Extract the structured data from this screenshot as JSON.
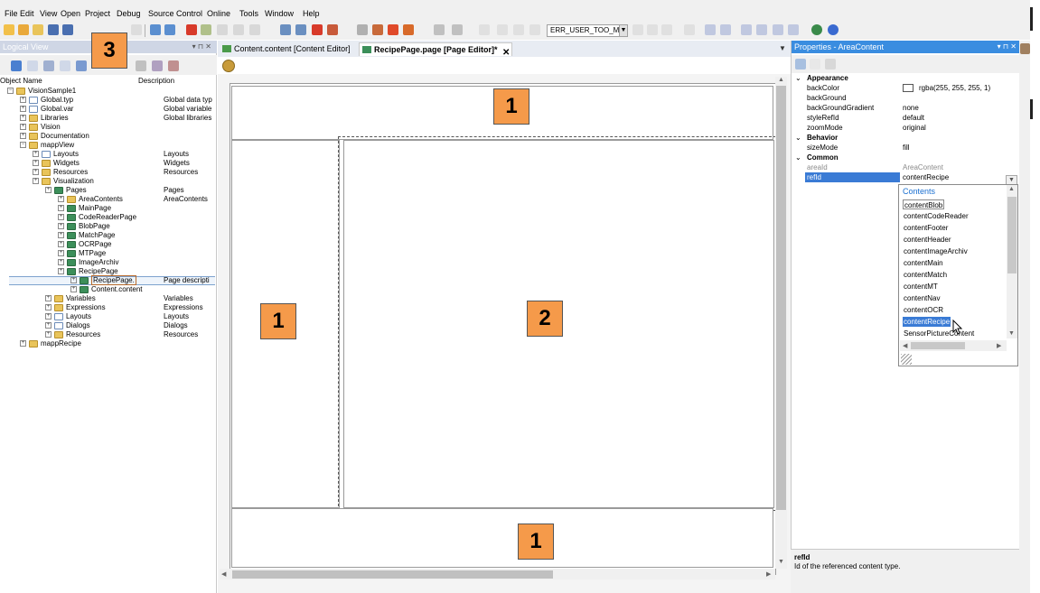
{
  "menu": [
    "File",
    "Edit",
    "View",
    "Open",
    "Project",
    "Debug",
    "Source Control",
    "Online",
    "Tools",
    "Window",
    "Help"
  ],
  "toolbar": {
    "error_combo_value": "ERR_USER_TOO_MA"
  },
  "logical_view": {
    "title": "Logical View",
    "col_object_name": "Object Name",
    "col_description": "Description",
    "tree": [
      {
        "label": "VisionSample1",
        "desc": "",
        "level": 0,
        "icon": "folder-icon"
      },
      {
        "label": "Global.typ",
        "desc": "Global data typ",
        "level": 1,
        "icon": "file-icon"
      },
      {
        "label": "Global.var",
        "desc": "Global variable",
        "level": 1,
        "icon": "file-icon"
      },
      {
        "label": "Libraries",
        "desc": "Global libraries",
        "level": 1,
        "icon": "folder-icon"
      },
      {
        "label": "Vision",
        "desc": "",
        "level": 1,
        "icon": "folder-icon"
      },
      {
        "label": "Documentation",
        "desc": "",
        "level": 1,
        "icon": "folder-icon"
      },
      {
        "label": "mappView",
        "desc": "",
        "level": 1,
        "icon": "folder-icon"
      },
      {
        "label": "Layouts",
        "desc": "Layouts",
        "level": 2,
        "icon": "file-icon"
      },
      {
        "label": "Widgets",
        "desc": "Widgets",
        "level": 2,
        "icon": "folder-icon"
      },
      {
        "label": "Resources",
        "desc": "Resources",
        "level": 2,
        "icon": "folder-icon"
      },
      {
        "label": "Visualization",
        "desc": "",
        "level": 2,
        "icon": "folder-icon"
      },
      {
        "label": "Pages",
        "desc": "Pages",
        "level": 3,
        "icon": "page-icon"
      },
      {
        "label": "AreaContents",
        "desc": "AreaContents",
        "level": 4,
        "icon": "folder-icon"
      },
      {
        "label": "MainPage",
        "desc": "",
        "level": 4,
        "icon": "page-icon"
      },
      {
        "label": "CodeReaderPage",
        "desc": "",
        "level": 4,
        "icon": "page-icon"
      },
      {
        "label": "BlobPage",
        "desc": "",
        "level": 4,
        "icon": "page-icon"
      },
      {
        "label": "MatchPage",
        "desc": "",
        "level": 4,
        "icon": "page-icon"
      },
      {
        "label": "OCRPage",
        "desc": "",
        "level": 4,
        "icon": "page-icon"
      },
      {
        "label": "MTPage",
        "desc": "",
        "level": 4,
        "icon": "page-icon"
      },
      {
        "label": "ImageArchiv",
        "desc": "",
        "level": 4,
        "icon": "page-icon"
      },
      {
        "label": "RecipePage",
        "desc": "",
        "level": 4,
        "icon": "page-icon"
      },
      {
        "label": "RecipePage.",
        "desc": "Page descripti",
        "level": 5,
        "icon": "page-icon",
        "selected": true
      },
      {
        "label": "Content.content",
        "desc": "",
        "level": 5,
        "icon": "page-icon"
      },
      {
        "label": "Variables",
        "desc": "Variables",
        "level": 3,
        "icon": "folder-icon"
      },
      {
        "label": "Expressions",
        "desc": "Expressions",
        "level": 3,
        "icon": "folder-icon"
      },
      {
        "label": "Layouts",
        "desc": "Layouts",
        "level": 3,
        "icon": "file-icon"
      },
      {
        "label": "Dialogs",
        "desc": "Dialogs",
        "level": 3,
        "icon": "file-icon"
      },
      {
        "label": "Resources",
        "desc": "Resources",
        "level": 3,
        "icon": "folder-icon"
      },
      {
        "label": "mappRecipe",
        "desc": "",
        "level": 1,
        "icon": "folder-icon"
      }
    ]
  },
  "editor": {
    "tabs": [
      {
        "label": "Content.content [Content Editor]",
        "active": false
      },
      {
        "label": "RecipePage.page [Page Editor]*",
        "active": true
      }
    ]
  },
  "badges": {
    "top": "1",
    "left": "1",
    "center": "2",
    "bottom": "1",
    "panel": "3"
  },
  "properties": {
    "title": "Properties - AreaContent",
    "rows": [
      {
        "name": "Appearance",
        "value": "",
        "category": true
      },
      {
        "name": "backColor",
        "value": "rgba(255, 255, 255, 1)",
        "swatch": true
      },
      {
        "name": "backGround",
        "value": ""
      },
      {
        "name": "backGroundGradient",
        "value": "none"
      },
      {
        "name": "styleRefId",
        "value": "default"
      },
      {
        "name": "zoomMode",
        "value": "original"
      },
      {
        "name": "Behavior",
        "value": "",
        "category": true
      },
      {
        "name": "sizeMode",
        "value": "fill"
      },
      {
        "name": "Common",
        "value": "",
        "category": true
      },
      {
        "name": "areaId",
        "value": "AreaContent",
        "muted": true
      },
      {
        "name": "refId",
        "value": "contentRecipe",
        "selected": true
      }
    ],
    "dropdown": {
      "header": "Contents",
      "items": [
        "contentBlob",
        "contentCodeReader",
        "contentFooter",
        "contentHeader",
        "contentImageArchiv",
        "contentMain",
        "contentMatch",
        "contentMT",
        "contentNav",
        "contentOCR",
        "contentRecipe",
        "SensorPictureContent"
      ],
      "boxed_index": 0,
      "selected_index": 10
    },
    "description_title": "refId",
    "description_text": "Id of the referenced content type."
  },
  "colors": {
    "accent": "#3a7bd5",
    "badge": "#f59a4a",
    "panel_header_active": "#3a8de0",
    "panel_header_inactive": "#cfd6e5"
  }
}
